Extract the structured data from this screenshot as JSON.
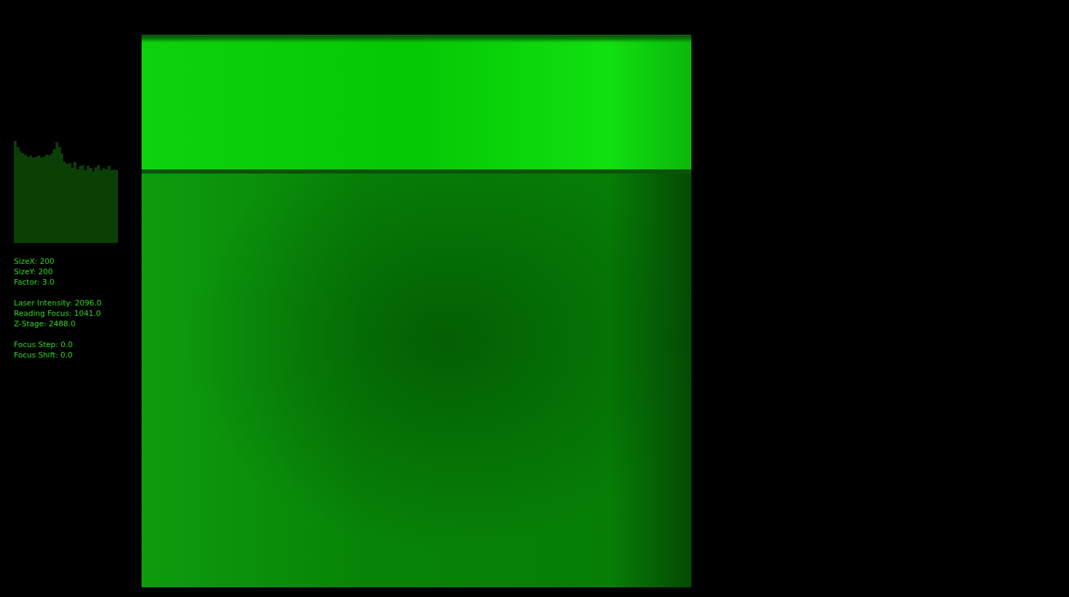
{
  "histogram": {
    "values": [
      98,
      92,
      88,
      86,
      85,
      83,
      84,
      82,
      83,
      84,
      82,
      83,
      85,
      84,
      86,
      90,
      97,
      92,
      86,
      78,
      76,
      77,
      72,
      78,
      71,
      74,
      75,
      70,
      74,
      72,
      69,
      73,
      75,
      70,
      72,
      71,
      74,
      70,
      71,
      70
    ]
  },
  "info_groups": [
    [
      "SizeX: 200",
      "SizeY: 200",
      "Factor: 3.0"
    ],
    [
      "Laser Intensity: 2096.0",
      "Reading Focus: 1041.0",
      "Z-Stage: 2488.0"
    ],
    [
      "Focus Step: 0.0",
      "Focus Shift: 0.0"
    ]
  ],
  "scan_image": {
    "kind": "microscope-frame"
  }
}
